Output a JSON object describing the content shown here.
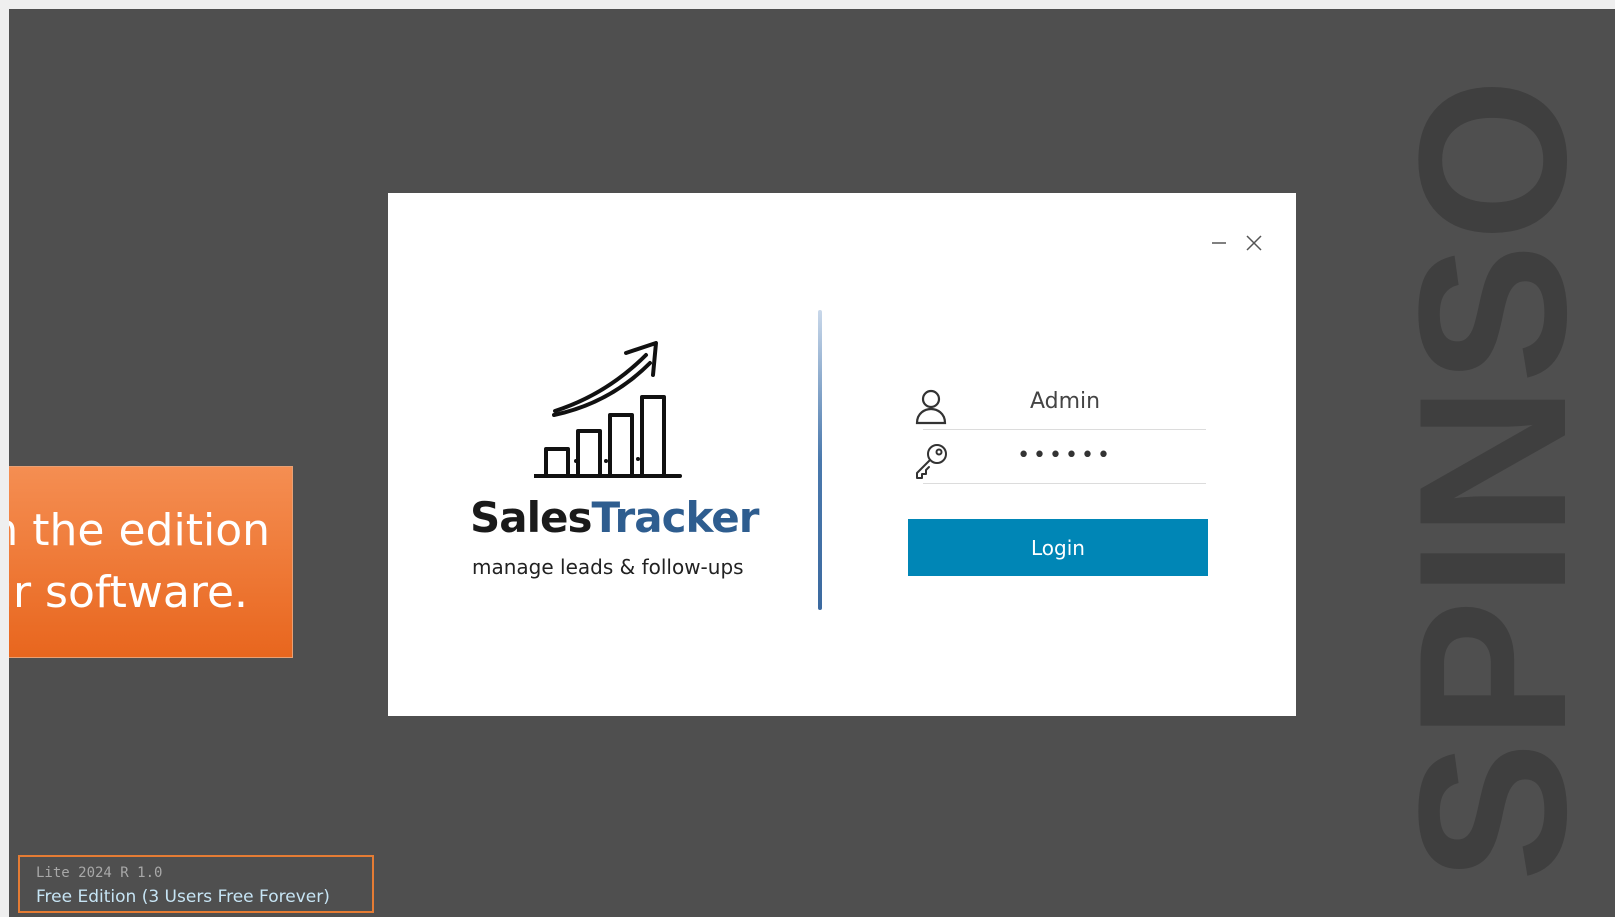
{
  "watermark": {
    "text": "SPINSO"
  },
  "callout": {
    "line1": "n the edition",
    "line2": "ur software."
  },
  "dialog": {
    "window_controls": {
      "minimize_icon": "minimize-icon",
      "close_icon": "close-icon"
    },
    "brand": {
      "name_part1": "Sales",
      "name_part2": "Tracker",
      "tagline": "manage leads & follow-ups",
      "logo_icon": "growth-chart-arrow-icon"
    },
    "login": {
      "username_icon": "user-icon",
      "username_value": "Admin",
      "password_icon": "key-icon",
      "password_value": "••••••",
      "login_label": "Login"
    }
  },
  "footer": {
    "version": "Lite 2024 R 1.0",
    "edition": "Free Edition (3 Users Free Forever)"
  },
  "colors": {
    "background": "#4f4f4f",
    "accent_orange": "#e8661e",
    "login_button": "#0086b6",
    "brand_blue": "#2e5d8f"
  }
}
